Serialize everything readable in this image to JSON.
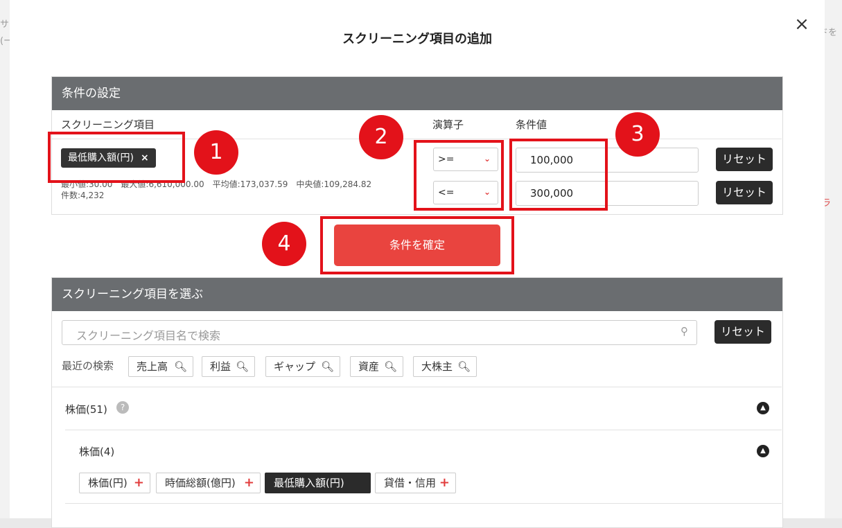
{
  "background": {
    "left_fragments": [
      "サ",
      "(ー"
    ],
    "right_fragments": [
      "ドを",
      "ラ"
    ]
  },
  "dialog": {
    "title": "スクリーニング項目の追加",
    "close_label": "×"
  },
  "conditions": {
    "header": "条件の設定",
    "col_item": "スクリーニング項目",
    "col_operator": "演算子",
    "col_value": "条件値",
    "selected_item": "最低購入額(円)",
    "remove_label": "×",
    "stats_line1": "最小値:30.00　最大値:6,610,000.00　平均値:173,037.59　中央値:109,284.82",
    "stats_line2": "件数:4,232",
    "rows": [
      {
        "operator": ">=",
        "value": "100,000",
        "reset": "リセット"
      },
      {
        "operator": "<=",
        "value": "300,000",
        "reset": "リセット"
      }
    ],
    "confirm_label": "条件を確定"
  },
  "annotations": [
    "1",
    "2",
    "3",
    "4"
  ],
  "picker": {
    "header": "スクリーニング項目を選ぶ",
    "search_placeholder": "スクリーニング項目名で検索",
    "search_reset": "リセット",
    "recent_label": "最近の検索",
    "recent_tags": [
      "売上高",
      "利益",
      "ギャップ",
      "資産",
      "大株主"
    ],
    "group": {
      "title": "株価(51)",
      "help": "?",
      "subgroup": {
        "title": "株価(4)",
        "items": [
          {
            "label": "株価(円)",
            "selected": false
          },
          {
            "label": "時価総額(億円)",
            "selected": false
          },
          {
            "label": "最低購入額(円)",
            "selected": true
          },
          {
            "label": "貸借・信用",
            "selected": false
          }
        ]
      }
    }
  }
}
